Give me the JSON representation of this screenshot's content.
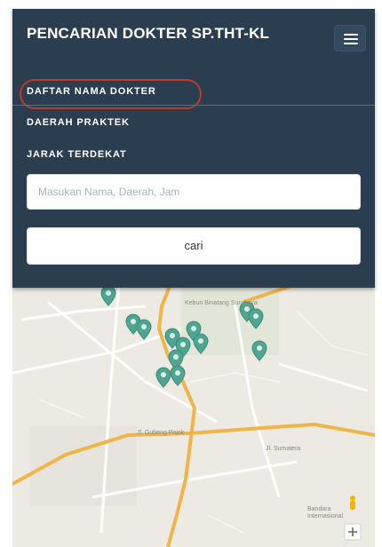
{
  "navbar": {
    "brand": "PENCARIAN DOKTER SP.THT-KL",
    "toggle_icon": "hamburger-menu-icon"
  },
  "nav": {
    "items": [
      {
        "label": "DAFTAR NAMA DOKTER",
        "highlighted": true
      },
      {
        "label": "DAERAH PRAKTEK",
        "highlighted": false
      },
      {
        "label": "JARAK TERDEKAT",
        "highlighted": false
      }
    ]
  },
  "search": {
    "placeholder": "Masukan Nama, Daerah, Jam",
    "value": ""
  },
  "button": {
    "label": "cari"
  },
  "map": {
    "labels": {
      "campus": "Kebun Binatang Surabaya",
      "road_main": "Jl. Gubeng Pojok",
      "road_side": "Jl. Sumatera",
      "airport": "Bandara Internasional"
    },
    "marker_icon": "map-pin-icon",
    "pegman_icon": "street-view-pegman-icon",
    "zoom_in_icon": "zoom-in-icon",
    "zoom_in_label": "+"
  },
  "colors": {
    "navbar_bg": "#2b3e50",
    "highlight_ring": "#c0392b",
    "marker": "#4fa58f",
    "road_major": "#f0b54a"
  }
}
